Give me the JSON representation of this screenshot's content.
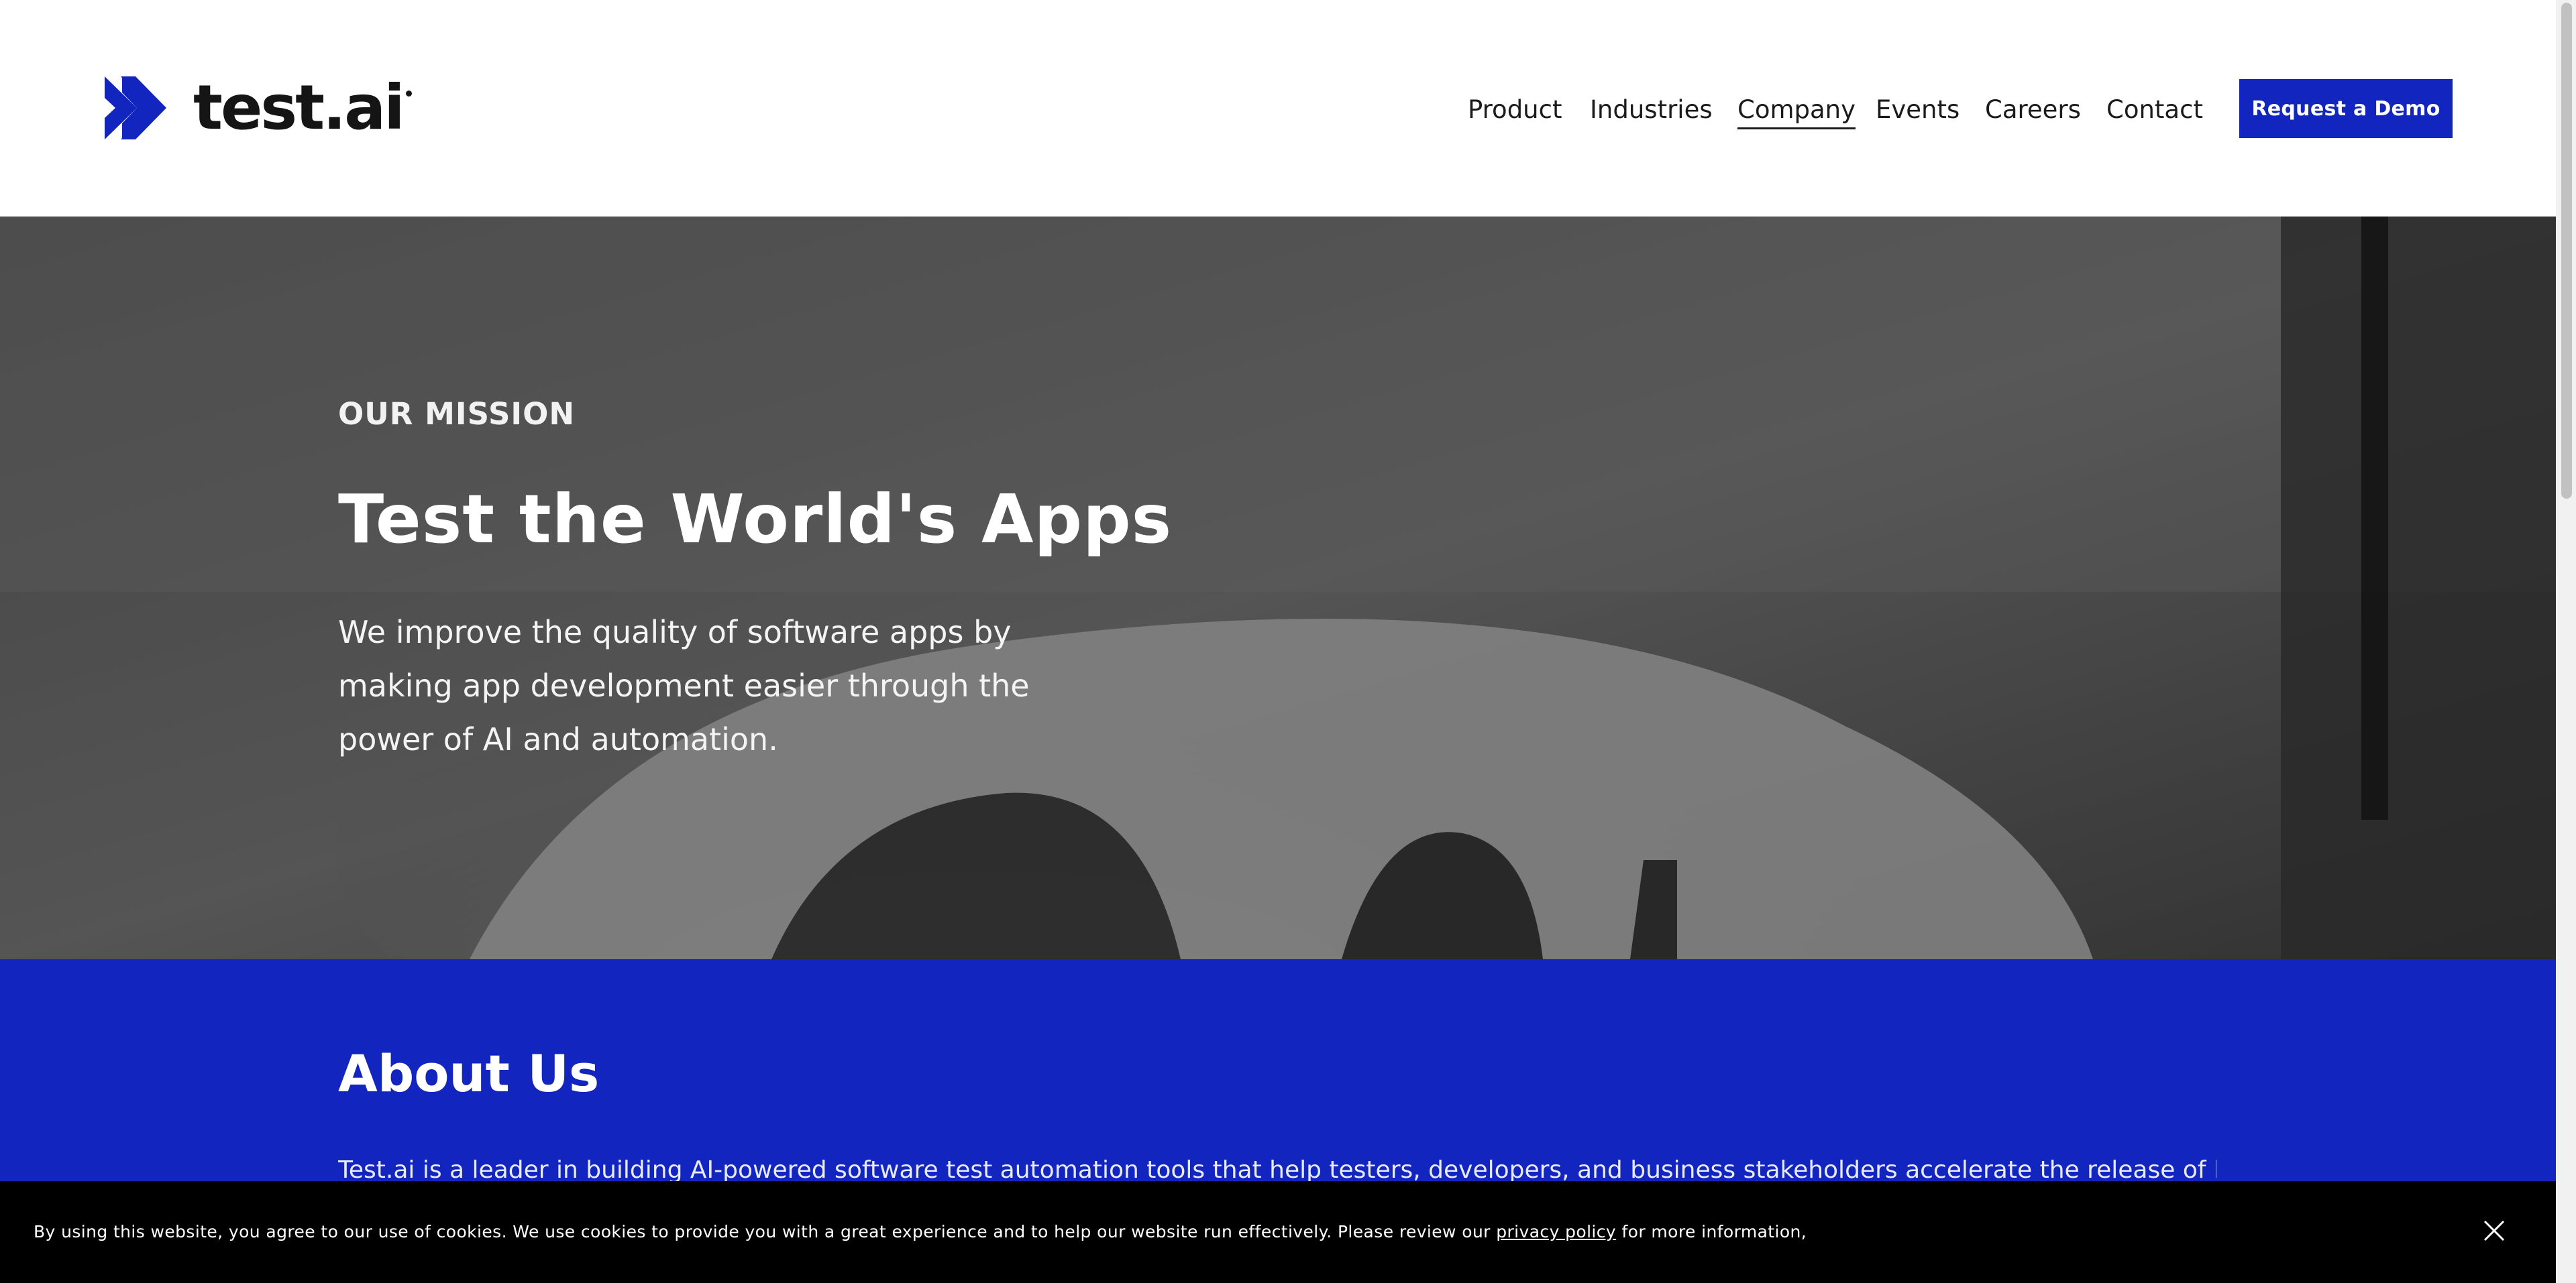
{
  "header": {
    "logo_text": "test.ai",
    "nav": [
      {
        "label": "Product"
      },
      {
        "label": "Industries"
      },
      {
        "label": "Company"
      },
      {
        "label": "Events"
      },
      {
        "label": "Careers"
      },
      {
        "label": "Contact"
      }
    ],
    "active_nav": "Company",
    "cta_label": "Request a Demo"
  },
  "hero": {
    "eyebrow": "OUR MISSION",
    "title": "Test the World's Apps",
    "description": "We improve the quality of software apps by making app development easier through the power of AI and automation."
  },
  "about": {
    "title": "About Us",
    "text": "Test.ai is a leader in building AI-powered software test automation tools that help testers, developers, and business stakeholders accelerate the release of high-quality"
  },
  "cookie": {
    "text_before": "By using this website, you agree to our use of cookies. We use cookies to provide you with a great experience and to help our website run effectively. Please review our ",
    "link_text": "privacy policy",
    "text_after": " for more information,"
  },
  "colors": {
    "brand_blue": "#1226bf",
    "text_dark": "#1b1b1b",
    "banner_bg": "#000000"
  },
  "icons": {
    "logo": "chevron-logo-icon",
    "close": "close-icon"
  }
}
